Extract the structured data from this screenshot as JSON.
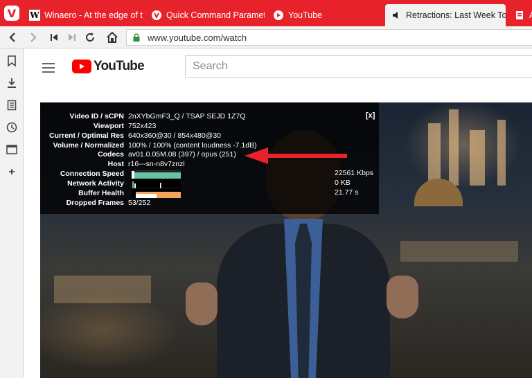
{
  "tabs": [
    {
      "label": "Winaero - At the edge of tw",
      "favicon": "winaero-icon"
    },
    {
      "label": "Quick Command Parameter",
      "favicon": "vivaldi-icon"
    },
    {
      "label": "YouTube",
      "favicon": "youtube-icon"
    },
    {
      "label": "Retractions: Last Week Tonig",
      "favicon": "speaker-icon"
    },
    {
      "label": "A",
      "favicon": "document-icon"
    }
  ],
  "addressbar": {
    "url": "www.youtube.com/watch"
  },
  "youtube": {
    "logo_text": "YouTube",
    "search_placeholder": "Search"
  },
  "stats": {
    "close_label": "[x]",
    "rows": [
      {
        "label": "Video ID / sCPN",
        "value": "2nXYbGmF3_Q / TSAP SEJD 1Z7Q"
      },
      {
        "label": "Viewport",
        "value": "752x423"
      },
      {
        "label": "Current / Optimal Res",
        "value": "640x360@30 / 854x480@30"
      },
      {
        "label": "Volume / Normalized",
        "value": "100% / 100% (content loudness -7.1dB)"
      },
      {
        "label": "Codecs",
        "value": "av01.0.05M.08 (397) / opus (251)"
      },
      {
        "label": "Host",
        "value": "r16---sn-n8v7znzl"
      },
      {
        "label": "Connection Speed",
        "value": "22561 Kbps"
      },
      {
        "label": "Network Activity",
        "value": "0 KB"
      },
      {
        "label": "Buffer Health",
        "value": "21.77 s"
      },
      {
        "label": "Dropped Frames",
        "value": "53/252"
      }
    ]
  },
  "colors": {
    "tabbar": "#e8222a",
    "youtube_red": "#ff0000",
    "graph_speed": "#67c3a2",
    "graph_buffer": "#f5a55c",
    "annotation_arrow": "#e8222a"
  }
}
